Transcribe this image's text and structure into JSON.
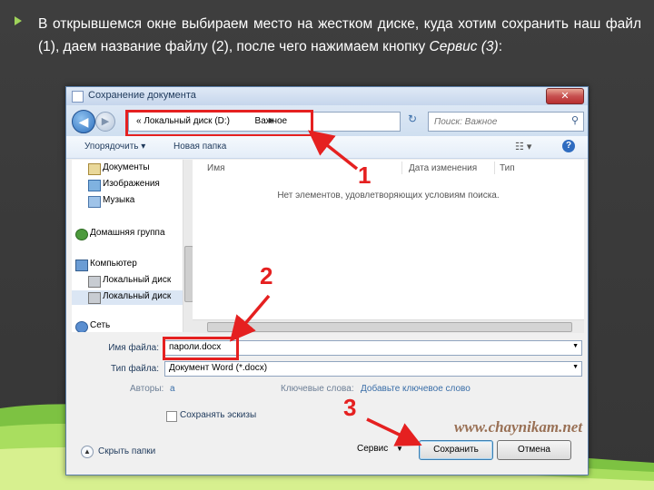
{
  "slide": {
    "paragraph": "В открывшемся окне выбираем место на жестком диске, куда хотим сохранить наш файл (1), даем название файлу (2), после чего нажимаем кнопку ",
    "paragraph_italic": "Сервис (3)",
    "paragraph_end": ":",
    "accent_color": "#9fd35a"
  },
  "dialog": {
    "title": "Сохранение документа",
    "close_label": "✕",
    "address": {
      "path": "« Локальный диск (D:)",
      "current": "Важное"
    },
    "search": {
      "placeholder": "Поиск: Важное"
    },
    "toolbar": {
      "organize": "Упорядочить ▾",
      "new_folder": "Новая папка"
    },
    "nav_items": [
      {
        "label": "Документы",
        "icon": "documents-icon"
      },
      {
        "label": "Изображения",
        "icon": "pictures-icon"
      },
      {
        "label": "Музыка",
        "icon": "music-icon"
      },
      {
        "label": "Домашняя группа",
        "icon": "homegroup-icon"
      },
      {
        "label": "Компьютер",
        "icon": "computer-icon"
      },
      {
        "label": "Локальный диск",
        "icon": "drive-icon"
      },
      {
        "label": "Локальный диск",
        "icon": "drive-icon"
      },
      {
        "label": "Сеть",
        "icon": "network-icon"
      }
    ],
    "columns": [
      "Имя",
      "Дата изменения",
      "Тип"
    ],
    "empty_message": "Нет элементов, удовлетворяющих условиям поиска.",
    "form": {
      "filename_label": "Имя файла:",
      "filename_value": "пароли.docx",
      "filetype_label": "Тип файла:",
      "filetype_value": "Документ Word (*.docx)",
      "authors_label": "Авторы:",
      "authors_value": "a",
      "keywords_label": "Ключевые слова:",
      "keywords_value": "Добавьте ключевое слово",
      "thumbnails_label": "Сохранять эскизы"
    },
    "footer": {
      "hide_folders": "Скрыть папки",
      "service": "Сервис",
      "save": "Сохранить",
      "cancel": "Отмена"
    }
  },
  "callouts": [
    "1",
    "2",
    "3"
  ],
  "watermark": "www.chaynikam.net",
  "highlight_color": "#e52020"
}
